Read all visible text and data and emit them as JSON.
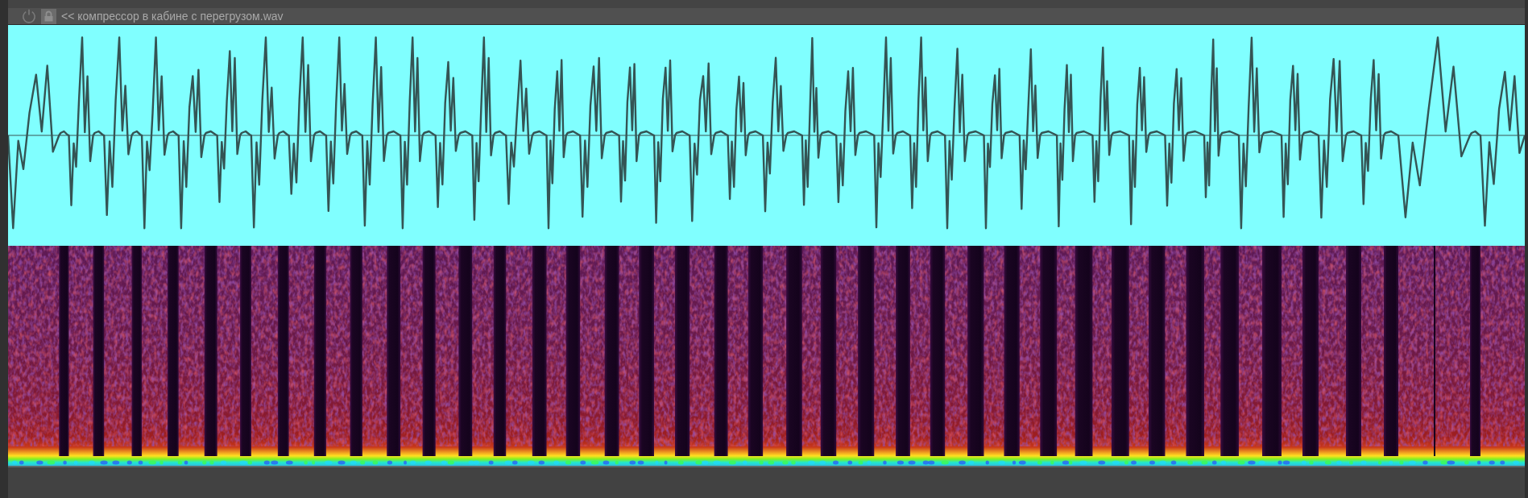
{
  "track": {
    "title": "<< компрессор в кабине с перегрузом.wav"
  }
}
